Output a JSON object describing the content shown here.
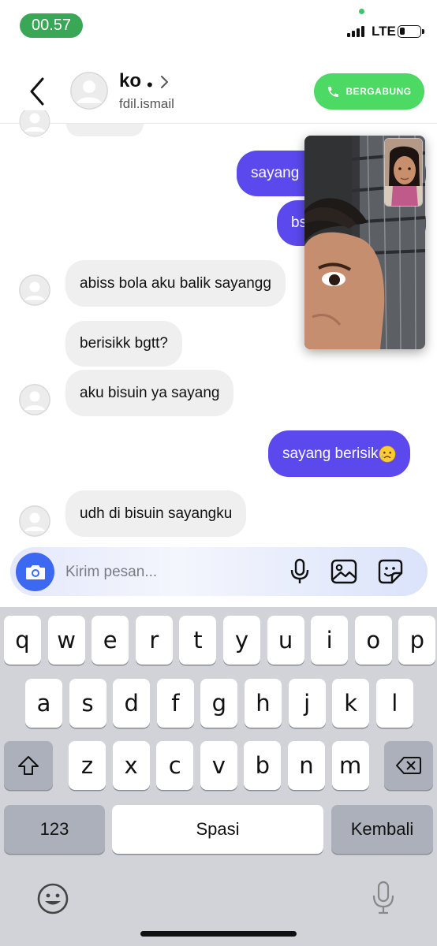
{
  "status_bar": {
    "time": "00.57",
    "network": "LTE",
    "battery_level": 0.25,
    "signal_bars": 4
  },
  "header": {
    "back_icon": "chevron-left-icon",
    "contact_name": "ko",
    "contact_separator": "•",
    "contact_handle": "fdil.ismail",
    "join_button_label": "BERGABUNG",
    "join_button_icon": "phone-icon",
    "join_button_color": "#4cd964"
  },
  "messages": [
    {
      "side": "out",
      "text": "sayang"
    },
    {
      "side": "out",
      "text": "bs"
    },
    {
      "side": "in",
      "text": "abiss bola aku balik sayangg"
    },
    {
      "side": "in",
      "text": "berisikk bgtt?"
    },
    {
      "side": "in",
      "text": "aku bisuin ya sayang"
    },
    {
      "side": "out",
      "text": "sayang berisik",
      "emoji": "crying-face-emoji"
    },
    {
      "side": "in",
      "text": "udh di bisuin sayangku"
    }
  ],
  "video_call": {
    "main_feed": "remote-video-feed",
    "self_view": "self-view-feed"
  },
  "composer": {
    "placeholder": "Kirim pesan...",
    "value": "",
    "camera_icon": "camera-icon",
    "icons": [
      "microphone-icon",
      "gallery-icon",
      "sticker-icon"
    ],
    "accent_color": "#3c68f2"
  },
  "keyboard": {
    "row1": [
      "q",
      "w",
      "e",
      "r",
      "t",
      "y",
      "u",
      "i",
      "o",
      "p"
    ],
    "row2": [
      "a",
      "s",
      "d",
      "f",
      "g",
      "h",
      "j",
      "k",
      "l"
    ],
    "row3": [
      "z",
      "x",
      "c",
      "v",
      "b",
      "n",
      "m"
    ],
    "numbers_key": "123",
    "space_key": "Spasi",
    "return_key": "Kembali",
    "shift_icon": "shift-icon",
    "delete_icon": "backspace-icon",
    "emoji_icon": "emoji-icon",
    "dictation_icon": "microphone-icon"
  },
  "colors": {
    "outgoing_bubble": "#5b49ee",
    "incoming_bubble": "#efefef"
  }
}
